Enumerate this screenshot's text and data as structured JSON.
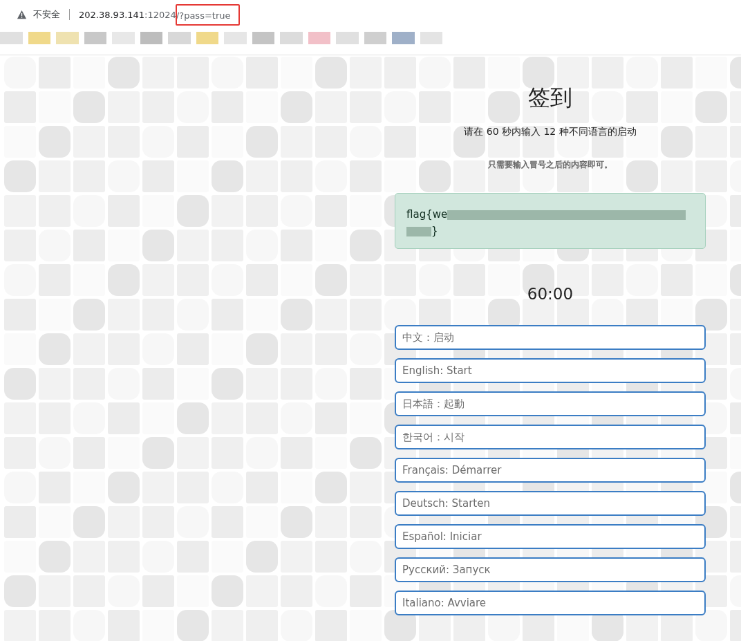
{
  "browser": {
    "security_label": "不安全",
    "url_host": "202.38.93.141",
    "url_port": ":12024",
    "url_path": "/?pass=true"
  },
  "page": {
    "title": "签到",
    "instruction": "请在 60 秒内输入 12 种不同语言的启动",
    "hint": "只需要输入冒号之后的内容即可。",
    "flag": {
      "start": "flag{we",
      "end": "}"
    },
    "timer": "60:00",
    "inputs": [
      {
        "placeholder": "中文：启动"
      },
      {
        "placeholder": "English: Start"
      },
      {
        "placeholder": "日本語：起動"
      },
      {
        "placeholder": "한국어：시작"
      },
      {
        "placeholder": "Français: Démarrer"
      },
      {
        "placeholder": "Deutsch: Starten"
      },
      {
        "placeholder": "Español: Iniciar"
      },
      {
        "placeholder": "Русский: Запуск"
      },
      {
        "placeholder": "Italiano: Avviare"
      }
    ]
  }
}
